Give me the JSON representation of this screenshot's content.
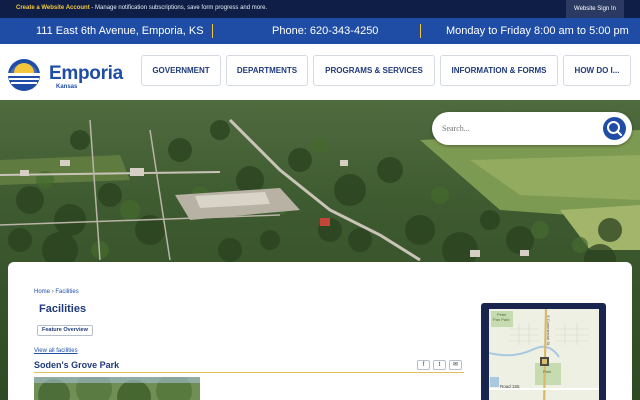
{
  "topbar": {
    "create_link": "Create a Website Account",
    "create_desc": " - Manage notification subscriptions, save form progress and more.",
    "sign_in": "Website Sign In"
  },
  "contact": {
    "address": "111 East 6th Avenue, Emporia, KS",
    "phone": "Phone: 620-343-4250",
    "hours": "Monday to Friday 8:00 am to 5:00 pm"
  },
  "logo": {
    "name": "Emporia",
    "state": "Kansas"
  },
  "nav": [
    "GOVERNMENT",
    "DEPARTMENTS",
    "PROGRAMS & SERVICES",
    "INFORMATION & FORMS",
    "HOW DO I..."
  ],
  "search": {
    "placeholder": "Search...",
    "icon": "magnifier-icon"
  },
  "breadcrumb": {
    "home": "Home",
    "sep": "›",
    "current": "Facilities"
  },
  "page": {
    "title": "Facilities",
    "feature_button": "Feature Overview",
    "view_all": "View all facilities",
    "facility_name": "Soden's Grove Park"
  },
  "share": {
    "facebook": "f",
    "twitter": "t",
    "email": "✉"
  },
  "map": {
    "labels": {
      "park_top_1": "Peter",
      "park_top_2": "Pan Park",
      "street": "S Commercial St",
      "park_mid": "Park",
      "road": "Road 155"
    }
  },
  "colors": {
    "navy": "#0f1e46",
    "brand_blue": "#1f4da6",
    "accent_gold": "#f3c63c",
    "nav_text": "#1f3a7a"
  }
}
